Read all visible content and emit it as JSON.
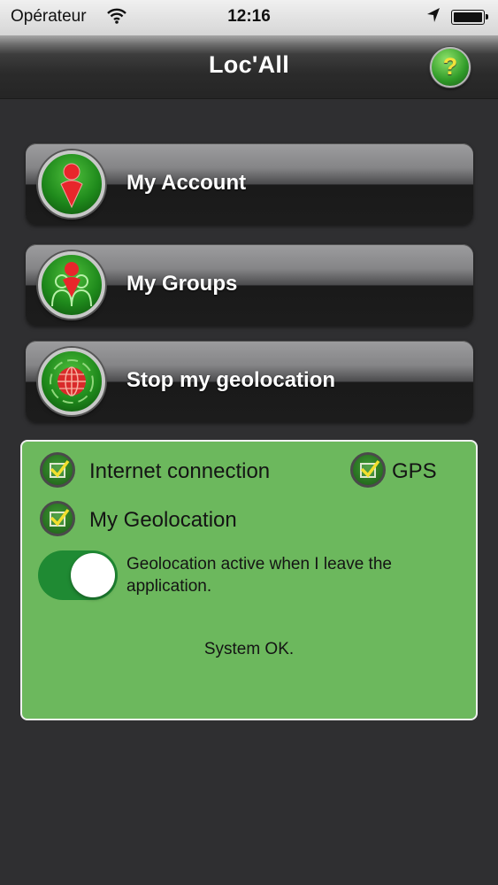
{
  "status_bar": {
    "carrier": "Opérateur",
    "time": "12:16",
    "wifi_icon": "wifi-icon",
    "location_icon": "location-arrow-icon",
    "battery_icon": "battery-icon"
  },
  "nav": {
    "title": "Loc'All",
    "help_label": "?"
  },
  "menu": {
    "items": [
      {
        "label": "My Account",
        "icon": "person-pin-icon"
      },
      {
        "label": "My Groups",
        "icon": "group-icon"
      },
      {
        "label": "Stop my geolocation",
        "icon": "globe-icon"
      }
    ]
  },
  "status_panel": {
    "internet_label": "Internet connection",
    "gps_label": "GPS",
    "geolocation_label": "My Geolocation",
    "toggle_label": "Geolocation active when I leave the application.",
    "toggle_on": true,
    "system_status": "System OK."
  },
  "colors": {
    "accent_green": "#6cb85d",
    "toggle_green": "#1f8a33",
    "background": "#2f2f31"
  }
}
